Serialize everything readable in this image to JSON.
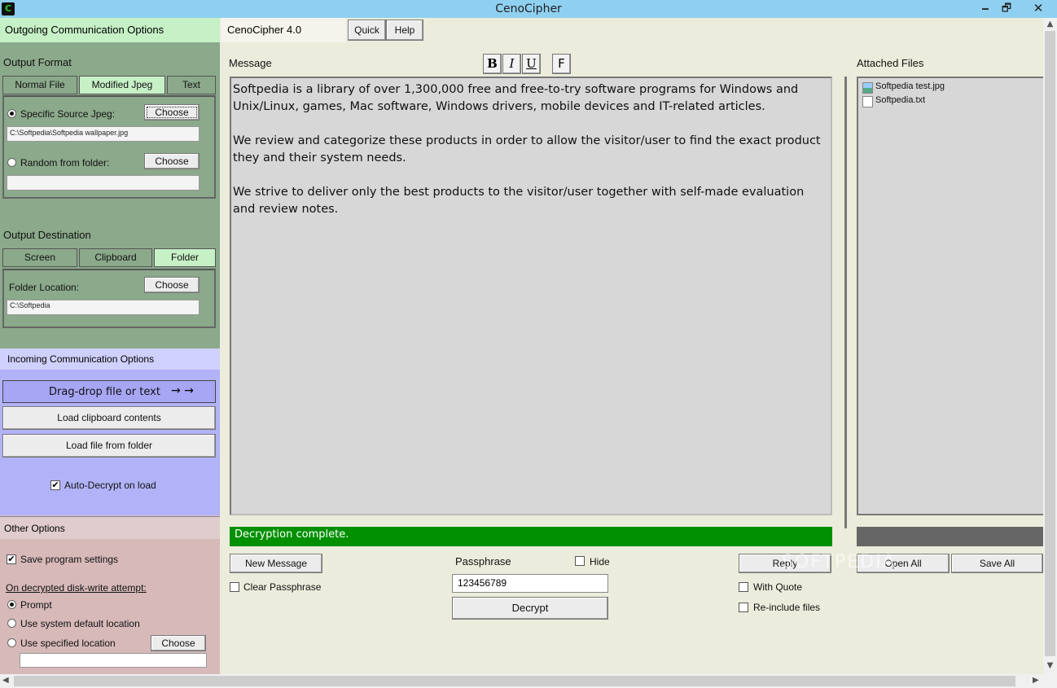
{
  "window": {
    "title": "CenoCipher",
    "app_icon": "C",
    "minimize": "🗕",
    "maximize": "🗗",
    "close": "✕"
  },
  "topbar": {
    "outgoing_header": "Outgoing Communication Options",
    "version": "CenoCipher 4.0",
    "quick_label": "Quick",
    "help_label": "Help"
  },
  "output_format": {
    "title": "Output Format",
    "tabs": [
      "Normal File",
      "Modified Jpeg",
      "Text"
    ],
    "active_tab": "Modified Jpeg",
    "specific_label": "Specific Source Jpeg:",
    "specific_choose": "Choose",
    "specific_path": "C:\\Softpedia\\Softpedia wallpaper.jpg",
    "random_label": "Random from folder:",
    "random_choose": "Choose",
    "random_path": ""
  },
  "output_destination": {
    "title": "Output Destination",
    "tabs": [
      "Screen",
      "Clipboard",
      "Folder"
    ],
    "active_tab": "Folder",
    "folder_label": "Folder Location:",
    "folder_choose": "Choose",
    "folder_path": "C:\\Softpedia"
  },
  "incoming": {
    "header": "Incoming Communication Options",
    "dragdrop_label": "Drag-drop file or text",
    "dragdrop_arrows": "→  →",
    "load_clipboard": "Load clipboard contents",
    "load_file": "Load file from folder",
    "auto_decrypt_label": "Auto-Decrypt on load",
    "auto_decrypt_checked": true
  },
  "other_options": {
    "header": "Other Options",
    "save_settings_label": "Save program settings",
    "save_settings_checked": true,
    "disk_write_label": "On decrypted disk-write attempt:",
    "radio_prompt": "Prompt",
    "radio_default": "Use system default location",
    "radio_specified": "Use specified location",
    "specified_choose": "Choose",
    "specified_path": ""
  },
  "message": {
    "label": "Message",
    "format_bold": "B",
    "format_italic": "I",
    "format_underline": "U",
    "format_font": "F",
    "paragraphs": [
      "Softpedia is a library of over 1,300,000 free and free-to-try software programs for Windows and Unix/Linux, games, Mac software, Windows drivers, mobile devices and IT-related articles.",
      "We review and categorize these products in order to allow the visitor/user to find the exact product they and their system needs.",
      "We strive to deliver only the best products to the visitor/user together with self-made evaluation and review notes."
    ],
    "status": "Decryption complete.",
    "status_color": "#009000"
  },
  "attachments": {
    "label": "Attached Files",
    "files": [
      {
        "name": "Softpedia test.jpg",
        "icon": "image-file-icon"
      },
      {
        "name": "Softpedia.txt",
        "icon": "text-file-icon"
      }
    ],
    "open_all": "Open All",
    "save_all": "Save All"
  },
  "bottom": {
    "new_message": "New Message",
    "clear_passphrase_label": "Clear Passphrase",
    "passphrase_label": "Passphrase",
    "hide_label": "Hide",
    "passphrase_value": "123456789",
    "decrypt_label": "Decrypt",
    "reply_label": "Reply",
    "with_quote_label": "With Quote",
    "reinclude_label": "Re-include files"
  },
  "watermark": "SOFTPEDIA"
}
